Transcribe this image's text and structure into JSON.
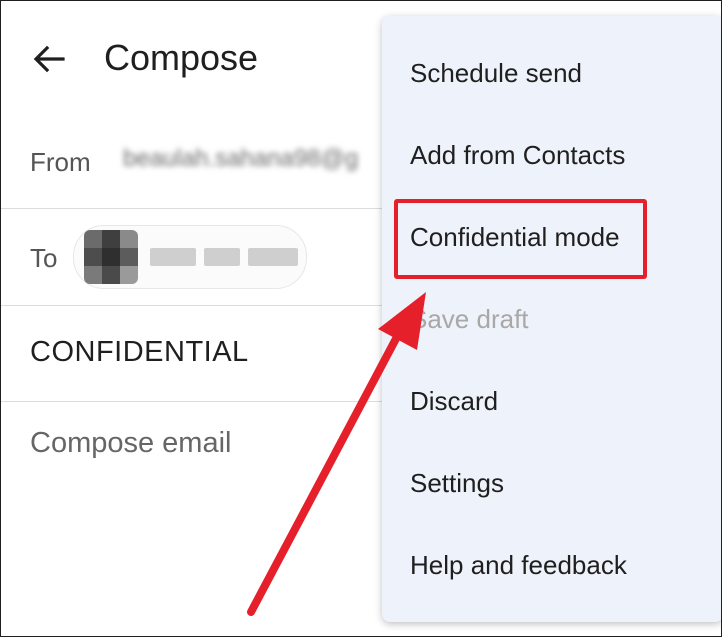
{
  "header": {
    "back_icon": "arrow-left-icon",
    "title": "Compose"
  },
  "from": {
    "label": "From",
    "value": "beaulah.sahana98@g"
  },
  "to": {
    "label": "To"
  },
  "subject": {
    "value": "CONFIDENTIAL"
  },
  "body": {
    "placeholder": "Compose email"
  },
  "menu": {
    "items": [
      {
        "label": "Schedule send",
        "enabled": true
      },
      {
        "label": "Add from Contacts",
        "enabled": true
      },
      {
        "label": "Confidential mode",
        "enabled": true,
        "highlighted": true
      },
      {
        "label": "Save draft",
        "enabled": false
      },
      {
        "label": "Discard",
        "enabled": true
      },
      {
        "label": "Settings",
        "enabled": true
      },
      {
        "label": "Help and feedback",
        "enabled": true
      }
    ]
  },
  "annotation": {
    "highlight_color": "#e5202b",
    "arrow_color": "#e5202b"
  }
}
